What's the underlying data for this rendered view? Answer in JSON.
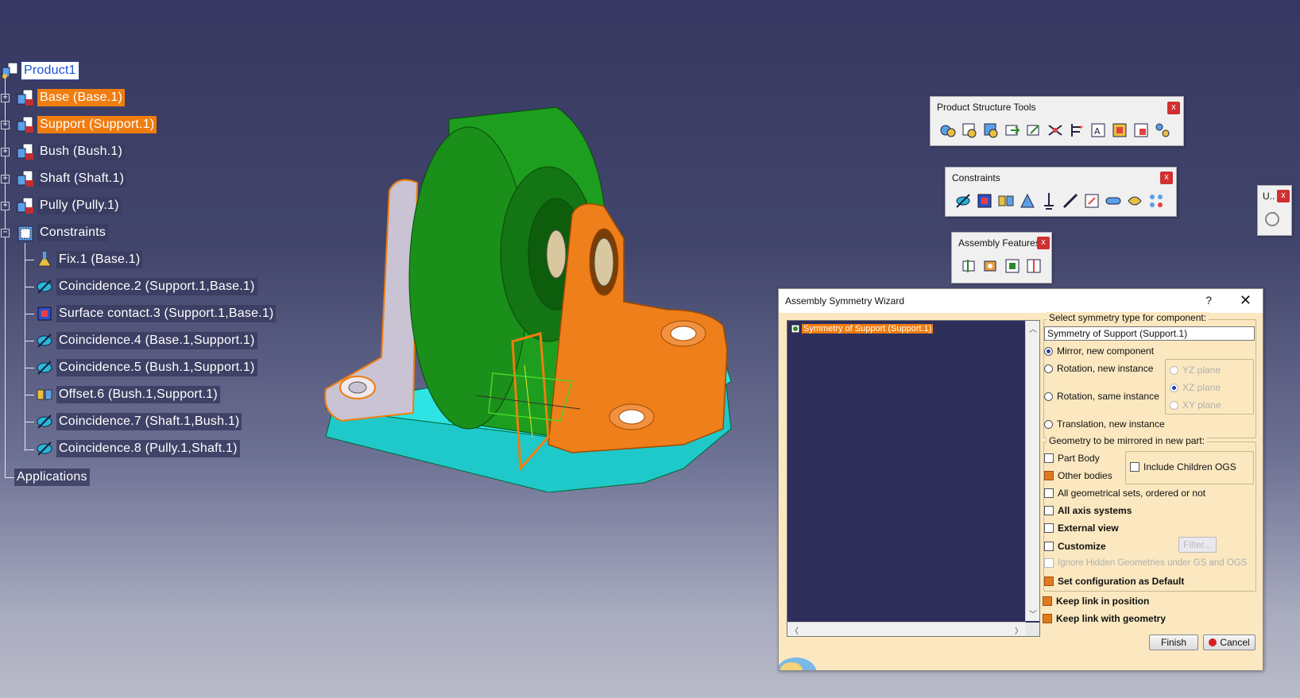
{
  "tree": {
    "root": "Product1",
    "nodes": [
      {
        "label": "Base (Base.1)",
        "state": "selected"
      },
      {
        "label": "Support (Support.1)",
        "state": "selected"
      },
      {
        "label": "Bush (Bush.1)",
        "state": "normal"
      },
      {
        "label": "Shaft (Shaft.1)",
        "state": "normal"
      },
      {
        "label": "Pully (Pully.1)",
        "state": "normal"
      },
      {
        "label": "Constraints",
        "state": "expanded"
      }
    ],
    "constraints": [
      {
        "label": "Fix.1 (Base.1)",
        "icon": "fix-icon"
      },
      {
        "label": "Coincidence.2 (Support.1,Base.1)",
        "icon": "coincidence-icon"
      },
      {
        "label": "Surface contact.3 (Support.1,Base.1)",
        "icon": "surface-contact-icon"
      },
      {
        "label": "Coincidence.4 (Base.1,Support.1)",
        "icon": "coincidence-icon"
      },
      {
        "label": "Coincidence.5 (Bush.1,Support.1)",
        "icon": "coincidence-icon"
      },
      {
        "label": "Offset.6 (Bush.1,Support.1)",
        "icon": "offset-icon"
      },
      {
        "label": "Coincidence.7 (Shaft.1,Bush.1)",
        "icon": "coincidence-icon"
      },
      {
        "label": "Coincidence.8 (Pully.1,Shaft.1)",
        "icon": "coincidence-icon"
      }
    ],
    "applications": "Applications"
  },
  "toolbars": {
    "product_structure": {
      "title": "Product Structure Tools",
      "close": "x"
    },
    "constraints": {
      "title": "Constraints",
      "close": "x"
    },
    "assembly_features": {
      "title": "Assembly Features",
      "close": "x"
    },
    "mini": {
      "title": "U..",
      "close": "x"
    }
  },
  "dialog": {
    "title": "Assembly Symmetry Wizard",
    "help": "?",
    "close": "✕",
    "list_item": "Symmetry of Support (Support.1)",
    "select_type_label": "Select symmetry type for component:",
    "component_value": "Symmetry of Support (Support.1)",
    "options": {
      "mirror": "Mirror, new component",
      "rotation_new": "Rotation, new instance",
      "rotation_same": "Rotation, same instance",
      "translation": "Translation, new instance"
    },
    "planes": {
      "yz": "YZ plane",
      "xz": "XZ plane",
      "xy": "XY plane"
    },
    "geometry_label": "Geometry to be mirrored in new part:",
    "part_body": "Part Body",
    "other_bodies": "Other bodies",
    "include_children": "Include Children OGS",
    "all_geo_sets": "All geometrical sets, ordered or not",
    "all_axis": "All axis systems",
    "external_view": "External view",
    "customize": "Customize",
    "filter": "Filter...",
    "ignore_hidden": "Ignore Hidden Geometries under GS and OGS",
    "set_config": "Set configuration as Default",
    "keep_position": "Keep link in position",
    "keep_geometry": "Keep link with geometry",
    "finish": "Finish",
    "cancel": "Cancel"
  }
}
